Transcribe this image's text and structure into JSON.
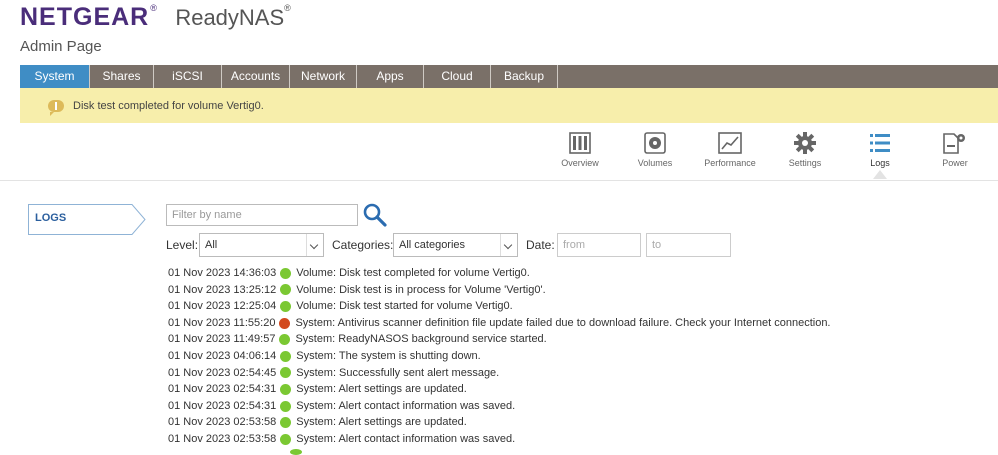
{
  "brand": {
    "name": "NETGEAR",
    "product": "ReadyNAS",
    "reg": "®"
  },
  "subtitle": "Admin Page",
  "tabs": [
    {
      "label": "System",
      "active": true,
      "width": 70
    },
    {
      "label": "Shares",
      "active": false,
      "width": 64
    },
    {
      "label": "iSCSI",
      "active": false,
      "width": 68
    },
    {
      "label": "Accounts",
      "active": false,
      "width": 68
    },
    {
      "label": "Network",
      "active": false,
      "width": 67
    },
    {
      "label": "Apps",
      "active": false,
      "width": 67
    },
    {
      "label": "Cloud",
      "active": false,
      "width": 67
    },
    {
      "label": "Backup",
      "active": false,
      "width": 67
    }
  ],
  "notice": {
    "text": "Disk test completed for volume Vertig0."
  },
  "icons": [
    {
      "label": "Overview",
      "icon": "overview-icon"
    },
    {
      "label": "Volumes",
      "icon": "volumes-icon"
    },
    {
      "label": "Performance",
      "icon": "performance-icon"
    },
    {
      "label": "Settings",
      "icon": "settings-icon"
    },
    {
      "label": "Logs",
      "icon": "logs-icon",
      "active": true
    },
    {
      "label": "Power",
      "icon": "power-icon"
    }
  ],
  "side": {
    "label": "LOGS"
  },
  "filter": {
    "placeholder": "Filter by name"
  },
  "level": {
    "label": "Level:",
    "value": "All"
  },
  "categories": {
    "label": "Categories:",
    "value": "All categories"
  },
  "date": {
    "label": "Date:",
    "from_placeholder": "from",
    "to_placeholder": "to"
  },
  "colors": {
    "ok": "#7bc832",
    "error": "#d24a1e",
    "accent": "#3f8dc5"
  },
  "logs": [
    {
      "time": "01 Nov 2023 14:36:03",
      "status": "ok",
      "message": "Volume: Disk test completed for volume Vertig0."
    },
    {
      "time": "01 Nov 2023 13:25:12",
      "status": "ok",
      "message": "Volume: Disk test is in process for Volume 'Vertig0'."
    },
    {
      "time": "01 Nov 2023 12:25:04",
      "status": "ok",
      "message": "Volume: Disk test started for volume Vertig0."
    },
    {
      "time": "01 Nov 2023 11:55:20",
      "status": "error",
      "message": "System: Antivirus scanner definition file update failed due to download failure. Check your Internet connection."
    },
    {
      "time": "01 Nov 2023 11:49:57",
      "status": "ok",
      "message": "System: ReadyNASOS background service started."
    },
    {
      "time": "01 Nov 2023 04:06:14",
      "status": "ok",
      "message": "System: The system is shutting down."
    },
    {
      "time": "01 Nov 2023 02:54:45",
      "status": "ok",
      "message": "System: Successfully sent alert message."
    },
    {
      "time": "01 Nov 2023 02:54:31",
      "status": "ok",
      "message": "System: Alert settings are updated."
    },
    {
      "time": "01 Nov 2023 02:54:31",
      "status": "ok",
      "message": "System: Alert contact information was saved."
    },
    {
      "time": "01 Nov 2023 02:53:58",
      "status": "ok",
      "message": "System: Alert settings are updated."
    },
    {
      "time": "01 Nov 2023 02:53:58",
      "status": "ok",
      "message": "System: Alert contact information was saved."
    }
  ]
}
